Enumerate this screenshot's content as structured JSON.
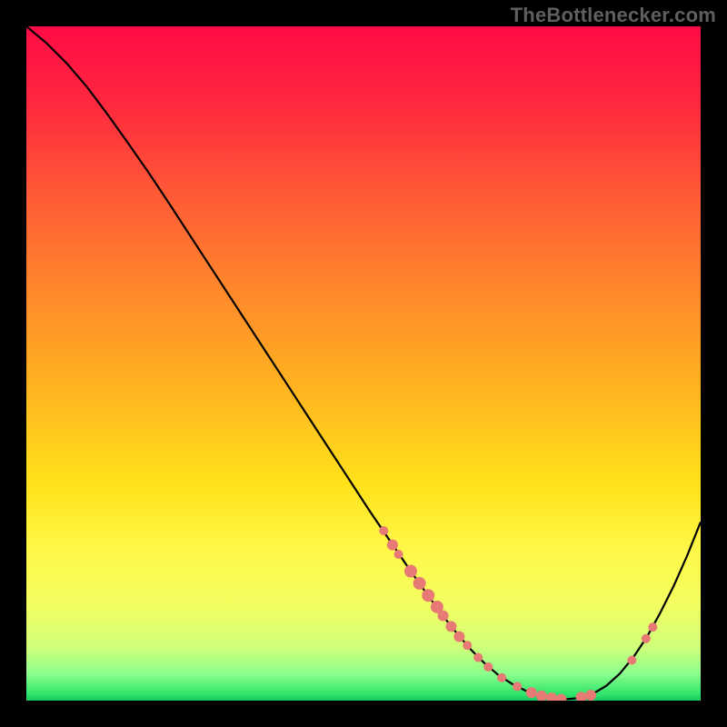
{
  "watermark": "TheBottlenecker.com",
  "colors": {
    "plot_border": "#000000",
    "curve_stroke": "#000000",
    "marker_fill": "#e77a74",
    "gradient_stops": [
      {
        "offset": "0%",
        "color": "#ff0b46"
      },
      {
        "offset": "12%",
        "color": "#ff2a3e"
      },
      {
        "offset": "25%",
        "color": "#ff5a36"
      },
      {
        "offset": "40%",
        "color": "#ff8a2a"
      },
      {
        "offset": "55%",
        "color": "#ffb81f"
      },
      {
        "offset": "68%",
        "color": "#ffe21a"
      },
      {
        "offset": "78%",
        "color": "#fff84a"
      },
      {
        "offset": "86%",
        "color": "#f2ff62"
      },
      {
        "offset": "92%",
        "color": "#d0ff7a"
      },
      {
        "offset": "96%",
        "color": "#8cff8c"
      },
      {
        "offset": "99%",
        "color": "#31e56b"
      },
      {
        "offset": "100%",
        "color": "#13c95f"
      }
    ]
  },
  "chart_data": {
    "type": "line",
    "title": "",
    "xlabel": "",
    "ylabel": "",
    "xlim": [
      0,
      100
    ],
    "ylim": [
      0,
      100
    ],
    "grid": false,
    "series": [
      {
        "name": "curve",
        "x": [
          0,
          3,
          6,
          9,
          12,
          15,
          18,
          21,
          24,
          27,
          30,
          33,
          36,
          39,
          42,
          45,
          48,
          51,
          54,
          57,
          60,
          62,
          64,
          66,
          68,
          70,
          72,
          74,
          76,
          78,
          80,
          82,
          84,
          86,
          88,
          90,
          92,
          94,
          96,
          98,
          100
        ],
        "y": [
          100,
          97.5,
          94.5,
          91,
          87,
          82.8,
          78.5,
          74,
          69.4,
          64.8,
          60.2,
          55.6,
          51,
          46.4,
          41.8,
          37.2,
          32.6,
          28,
          23.6,
          19.2,
          15,
          12.3,
          9.8,
          7.5,
          5.5,
          3.8,
          2.5,
          1.5,
          0.8,
          0.4,
          0.2,
          0.4,
          1,
          2.2,
          4,
          6.4,
          9.4,
          13,
          17,
          21.5,
          26.5
        ]
      }
    ],
    "markers": [
      {
        "x": 53.0,
        "y": 25.2,
        "r": 5
      },
      {
        "x": 54.3,
        "y": 23.1,
        "r": 6
      },
      {
        "x": 55.2,
        "y": 21.7,
        "r": 5
      },
      {
        "x": 57.0,
        "y": 19.2,
        "r": 7
      },
      {
        "x": 58.3,
        "y": 17.4,
        "r": 7
      },
      {
        "x": 59.6,
        "y": 15.6,
        "r": 7
      },
      {
        "x": 60.9,
        "y": 13.9,
        "r": 7
      },
      {
        "x": 61.8,
        "y": 12.6,
        "r": 6
      },
      {
        "x": 63.0,
        "y": 11.0,
        "r": 6
      },
      {
        "x": 64.2,
        "y": 9.5,
        "r": 6
      },
      {
        "x": 65.4,
        "y": 8.2,
        "r": 5
      },
      {
        "x": 67.0,
        "y": 6.4,
        "r": 5
      },
      {
        "x": 68.5,
        "y": 5.0,
        "r": 5
      },
      {
        "x": 70.5,
        "y": 3.4,
        "r": 5
      },
      {
        "x": 72.8,
        "y": 2.1,
        "r": 5
      },
      {
        "x": 74.9,
        "y": 1.2,
        "r": 6
      },
      {
        "x": 76.4,
        "y": 0.7,
        "r": 6
      },
      {
        "x": 77.9,
        "y": 0.4,
        "r": 6
      },
      {
        "x": 79.3,
        "y": 0.2,
        "r": 6
      },
      {
        "x": 82.3,
        "y": 0.5,
        "r": 6
      },
      {
        "x": 83.7,
        "y": 0.8,
        "r": 6
      },
      {
        "x": 89.8,
        "y": 6.0,
        "r": 5
      },
      {
        "x": 91.9,
        "y": 9.2,
        "r": 5
      },
      {
        "x": 92.9,
        "y": 10.9,
        "r": 5
      }
    ]
  }
}
